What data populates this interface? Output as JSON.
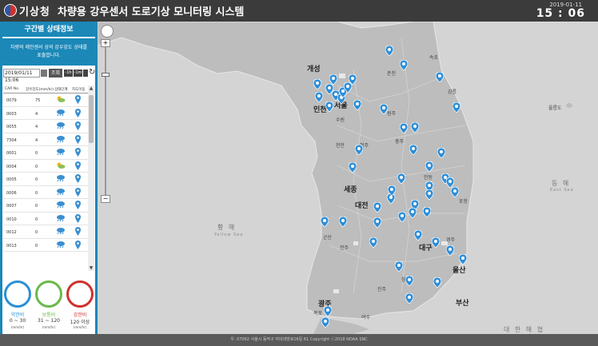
{
  "header": {
    "logo_text": "기상청",
    "title": "차량용 강우센서 도로기상 모니터링 시스템",
    "date": "2019-01-11",
    "time": "15 : 06"
  },
  "sidebar": {
    "panel_title": "구간별 상태정보",
    "notice_line1": "차량의 레인센서 상의 강우강도 상태를",
    "notice_line2": "표출합니다.",
    "date_value": "2019/01/11 15:06",
    "query_label": "조회",
    "prev_label": "-1h",
    "next_label": "+1h",
    "now_label": "-1m",
    "table_headers": [
      "CAR No.",
      "강우강도(mm/hr)",
      "상태단계",
      "지도이동"
    ],
    "rows": [
      {
        "car": "0079",
        "rain": "75",
        "wx": "sun-cloud"
      },
      {
        "car": "0003",
        "rain": "4",
        "wx": "rain"
      },
      {
        "car": "0055",
        "rain": "4",
        "wx": "rain"
      },
      {
        "car": "7304",
        "rain": "4",
        "wx": "rain"
      },
      {
        "car": "0001",
        "rain": "0",
        "wx": "rain"
      },
      {
        "car": "0004",
        "rain": "0",
        "wx": "sun-cloud"
      },
      {
        "car": "0005",
        "rain": "0",
        "wx": "rain"
      },
      {
        "car": "0006",
        "rain": "0",
        "wx": "rain"
      },
      {
        "car": "0007",
        "rain": "0",
        "wx": "rain"
      },
      {
        "car": "0010",
        "rain": "0",
        "wx": "rain"
      },
      {
        "car": "0012",
        "rain": "0",
        "wx": "rain"
      },
      {
        "car": "0013",
        "rain": "0",
        "wx": "rain"
      }
    ],
    "section_title": "구간 상태",
    "gauges": [
      {
        "name": "약한비",
        "range": "0 ~ 30",
        "unit": "(mm/hr)",
        "color": "#2b8fd6"
      },
      {
        "name": "보통비",
        "range": "31 ~ 120",
        "unit": "(mm/hr)",
        "color": "#6ab84a"
      },
      {
        "name": "강한비",
        "range": "120 이상",
        "unit": "(mm/hr)",
        "color": "#d0312d"
      }
    ]
  },
  "map": {
    "places": [
      {
        "name": "개성",
        "big": true
      },
      {
        "name": "인천",
        "big": true
      },
      {
        "name": "서울",
        "big": true
      },
      {
        "name": "세종",
        "big": true
      },
      {
        "name": "대전",
        "big": true
      },
      {
        "name": "대구",
        "big": true
      },
      {
        "name": "울산",
        "big": true
      },
      {
        "name": "부산",
        "big": true
      },
      {
        "name": "광주",
        "big": true
      },
      {
        "name": "강릉",
        "big": false
      },
      {
        "name": "원주",
        "big": false
      },
      {
        "name": "충주",
        "big": false
      },
      {
        "name": "청주",
        "big": false
      },
      {
        "name": "전주",
        "big": false
      },
      {
        "name": "포항",
        "big": false
      },
      {
        "name": "안동",
        "big": false
      },
      {
        "name": "경주",
        "big": false
      },
      {
        "name": "목포",
        "big": false
      },
      {
        "name": "여수",
        "big": false
      },
      {
        "name": "천안",
        "big": false
      },
      {
        "name": "수원",
        "big": false
      },
      {
        "name": "춘천",
        "big": false
      },
      {
        "name": "속초",
        "big": false
      },
      {
        "name": "군산",
        "big": false
      },
      {
        "name": "진주",
        "big": false
      },
      {
        "name": "창원",
        "big": false
      },
      {
        "name": "울릉도",
        "big": false
      }
    ],
    "sea_west": "황 해",
    "sea_west_en": "Yellow Sea",
    "sea_east": "동 해",
    "sea_east_en": "East Sea",
    "strait": "대 한 해 협",
    "marker_color": "#2f8fd8"
  },
  "footer": {
    "text": "우. 07062 서울시 동작구 여의대방로16길 61 Copyright ⓒ2018 NOAA SNC"
  }
}
